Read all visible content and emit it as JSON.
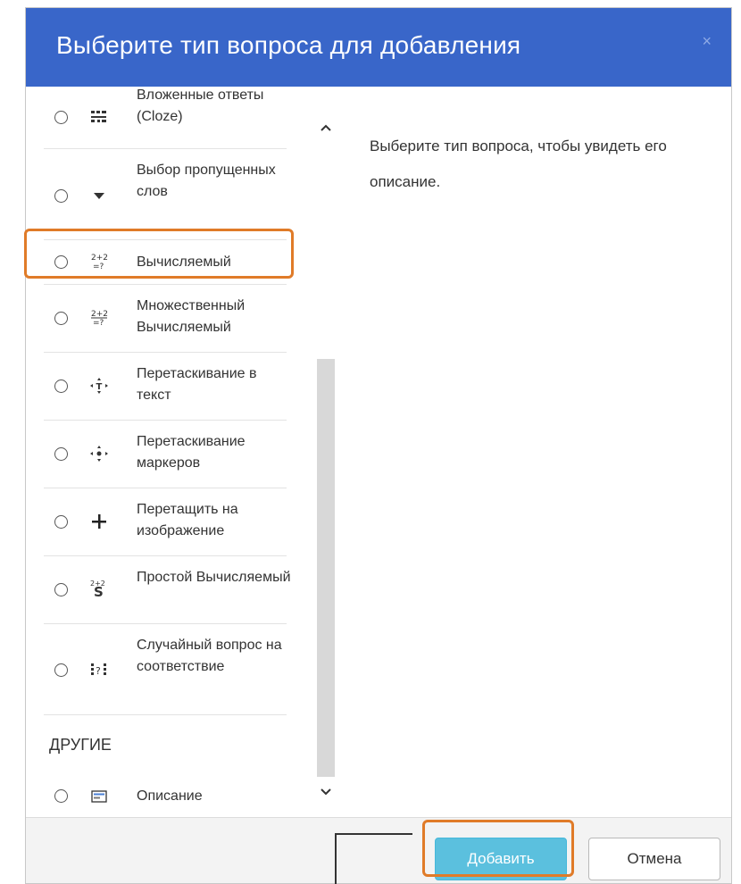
{
  "dialog": {
    "title": "Выберите тип вопроса для добавления",
    "close_glyph": "×"
  },
  "question_types": [
    {
      "label": "Вложенные ответы (Cloze)",
      "icon": "cloze-icon",
      "selected": false
    },
    {
      "label": "Выбор пропущенных слов",
      "icon": "dropdown-icon",
      "selected": false
    },
    {
      "label": "Вычисляемый",
      "icon": "calculated-icon",
      "selected": false,
      "highlighted": true
    },
    {
      "label": "Множественный Вычисляемый",
      "icon": "multi-calculated-icon",
      "selected": false
    },
    {
      "label": "Перетаскивание в текст",
      "icon": "drag-text-icon",
      "selected": false
    },
    {
      "label": "Перетаскивание маркеров",
      "icon": "drag-markers-icon",
      "selected": false
    },
    {
      "label": "Перетащить на изображение",
      "icon": "drag-image-icon",
      "selected": false
    },
    {
      "label": "Простой Вычисляемый",
      "icon": "simple-calculated-icon",
      "selected": false
    },
    {
      "label": "Случайный вопрос на соответствие",
      "icon": "random-match-icon",
      "selected": false
    }
  ],
  "section_other": {
    "heading": "ДРУГИЕ",
    "items": [
      {
        "label": "Описание",
        "icon": "description-icon",
        "selected": false
      }
    ]
  },
  "description_panel": {
    "text": "Выберите тип вопроса, чтобы увидеть его описание."
  },
  "footer": {
    "add_label": "Добавить",
    "cancel_label": "Отмена"
  },
  "colors": {
    "header_bg": "#3966c9",
    "add_button_bg": "#5bc0de",
    "highlight_border": "#e07b28"
  }
}
